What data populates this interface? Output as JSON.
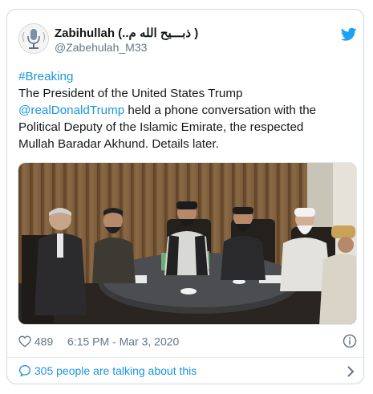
{
  "tweet": {
    "display_name": "Zabihullah (..ذبـــیح الله م )",
    "handle": "@Zabehulah_M33",
    "text_lines": [
      [
        {
          "t": "#Breaking",
          "link": true
        }
      ],
      [
        {
          "t": "The President of the United States Trump",
          "link": false
        }
      ],
      [
        {
          "t": "@realDonaldTrump",
          "link": true
        },
        {
          "t": " held a phone conversation with the",
          "link": false
        }
      ],
      [
        {
          "t": "Political Deputy of the Islamic Emirate, the respected",
          "link": false
        }
      ],
      [
        {
          "t": "Mullah Baradar Akhund. Details later.",
          "link": false
        }
      ]
    ],
    "likes": "489",
    "timestamp": "6:15 PM - Mar 3, 2020",
    "conversation": "305 people are talking about this"
  },
  "colors": {
    "link": "#1b95e0",
    "text": "#14171a",
    "muted": "#657786",
    "twitter_blue": "#1da1f2"
  },
  "icons": [
    "twitter-bird-icon",
    "heart-icon",
    "info-icon",
    "speech-bubble-icon",
    "chevron-right-icon"
  ]
}
